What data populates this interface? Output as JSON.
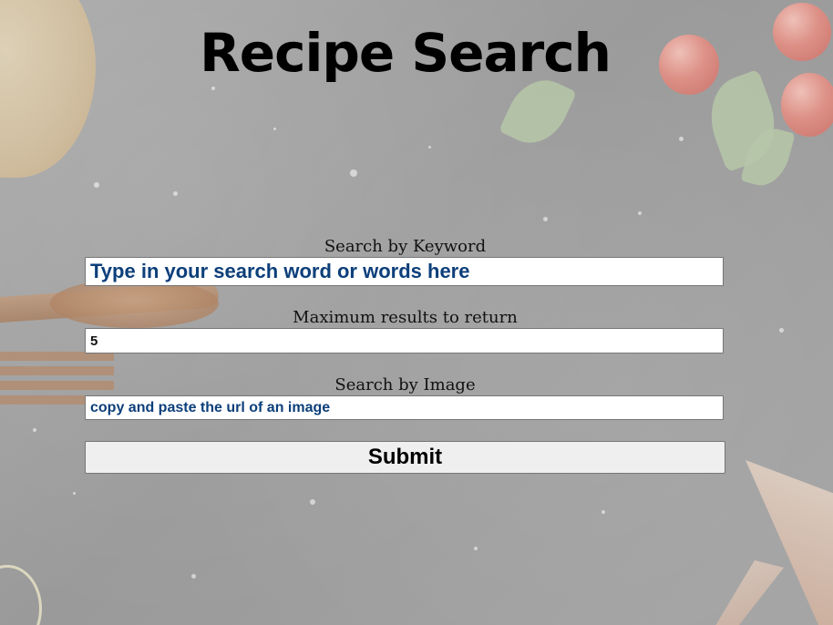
{
  "page": {
    "title": "Recipe Search"
  },
  "form": {
    "keyword": {
      "label": "Search by Keyword",
      "placeholder": "Type in your search word or words here",
      "value": ""
    },
    "max_results": {
      "label": "Maximum results to return",
      "value": "5"
    },
    "image": {
      "label": "Search by Image",
      "placeholder": "copy and paste the url of an image",
      "value": ""
    },
    "submit_label": "Submit"
  },
  "colors": {
    "placeholder_text": "#0c3f7a",
    "input_bg": "#ffffff",
    "button_bg": "#efefef"
  }
}
